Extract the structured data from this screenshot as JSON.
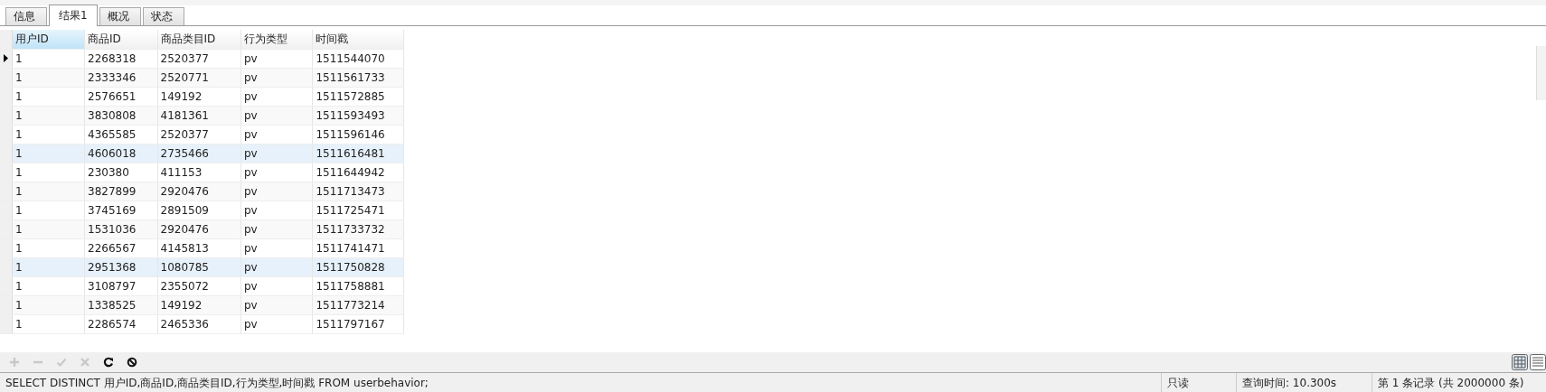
{
  "tabs": [
    {
      "label": "信息",
      "selected": false
    },
    {
      "label": "结果1",
      "selected": true
    },
    {
      "label": "概况",
      "selected": false
    },
    {
      "label": "状态",
      "selected": false
    }
  ],
  "table": {
    "columns": [
      {
        "label": "用户ID",
        "selected": true
      },
      {
        "label": "商品ID",
        "selected": false
      },
      {
        "label": "商品类目ID",
        "selected": false
      },
      {
        "label": "行为类型",
        "selected": false
      },
      {
        "label": "时间戳",
        "selected": false
      }
    ],
    "rows": [
      {
        "current": true,
        "highlighted": false,
        "cells": [
          "1",
          "2268318",
          "2520377",
          "pv",
          "1511544070"
        ]
      },
      {
        "current": false,
        "highlighted": false,
        "cells": [
          "1",
          "2333346",
          "2520771",
          "pv",
          "1511561733"
        ]
      },
      {
        "current": false,
        "highlighted": false,
        "cells": [
          "1",
          "2576651",
          "149192",
          "pv",
          "1511572885"
        ]
      },
      {
        "current": false,
        "highlighted": false,
        "cells": [
          "1",
          "3830808",
          "4181361",
          "pv",
          "1511593493"
        ]
      },
      {
        "current": false,
        "highlighted": false,
        "cells": [
          "1",
          "4365585",
          "2520377",
          "pv",
          "1511596146"
        ]
      },
      {
        "current": false,
        "highlighted": true,
        "cells": [
          "1",
          "4606018",
          "2735466",
          "pv",
          "1511616481"
        ]
      },
      {
        "current": false,
        "highlighted": false,
        "cells": [
          "1",
          "230380",
          "411153",
          "pv",
          "1511644942"
        ]
      },
      {
        "current": false,
        "highlighted": false,
        "cells": [
          "1",
          "3827899",
          "2920476",
          "pv",
          "1511713473"
        ]
      },
      {
        "current": false,
        "highlighted": false,
        "cells": [
          "1",
          "3745169",
          "2891509",
          "pv",
          "1511725471"
        ]
      },
      {
        "current": false,
        "highlighted": false,
        "cells": [
          "1",
          "1531036",
          "2920476",
          "pv",
          "1511733732"
        ]
      },
      {
        "current": false,
        "highlighted": false,
        "cells": [
          "1",
          "2266567",
          "4145813",
          "pv",
          "1511741471"
        ]
      },
      {
        "current": false,
        "highlighted": true,
        "cells": [
          "1",
          "2951368",
          "1080785",
          "pv",
          "1511750828"
        ]
      },
      {
        "current": false,
        "highlighted": false,
        "cells": [
          "1",
          "3108797",
          "2355072",
          "pv",
          "1511758881"
        ]
      },
      {
        "current": false,
        "highlighted": false,
        "cells": [
          "1",
          "1338525",
          "149192",
          "pv",
          "1511773214"
        ]
      },
      {
        "current": false,
        "highlighted": false,
        "cells": [
          "1",
          "2286574",
          "2465336",
          "pv",
          "1511797167"
        ]
      }
    ]
  },
  "toolbar": {
    "buttons": [
      {
        "kind": "add",
        "disabled": true
      },
      {
        "kind": "delete",
        "disabled": true
      },
      {
        "kind": "apply",
        "disabled": true
      },
      {
        "kind": "cancel",
        "disabled": true
      },
      {
        "kind": "refresh",
        "disabled": false
      },
      {
        "kind": "stop",
        "disabled": false
      }
    ],
    "views": [
      {
        "kind": "grid",
        "selected": true
      },
      {
        "kind": "form",
        "selected": false
      }
    ]
  },
  "status_bar": {
    "query": "SELECT DISTINCT 用户ID,商品ID,商品类目ID,行为类型,时间戳 FROM userbehavior;",
    "mode": "只读",
    "query_time": "查询时间: 10.300s",
    "record": "第 1 条记录 (共 2000000 条)"
  }
}
